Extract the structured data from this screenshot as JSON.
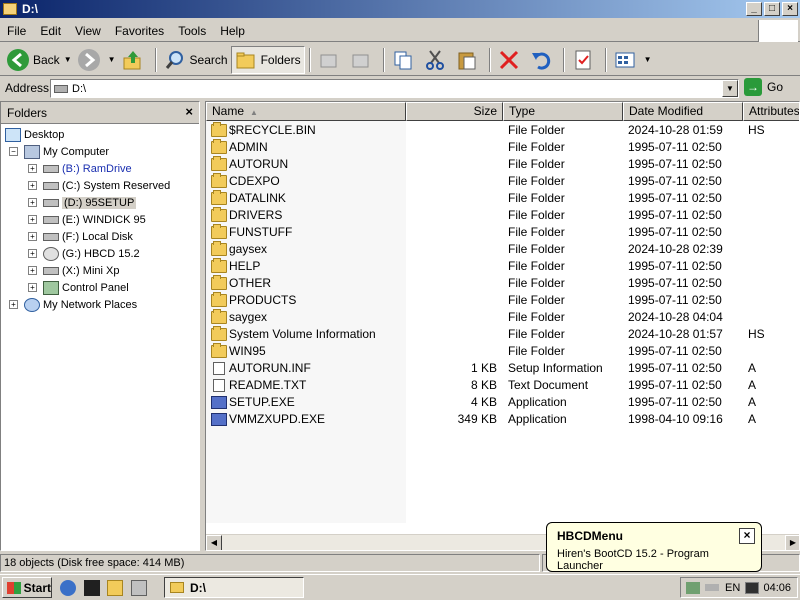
{
  "window": {
    "title": "D:\\",
    "buttons": {
      "minimize": "_",
      "maximize": "□",
      "close": "×"
    }
  },
  "menu": [
    "File",
    "Edit",
    "View",
    "Favorites",
    "Tools",
    "Help"
  ],
  "toolbar": {
    "back": "Back",
    "search": "Search",
    "folders": "Folders"
  },
  "address": {
    "label": "Address",
    "value": "D:\\",
    "go": "Go"
  },
  "folders_pane": {
    "title": "Folders",
    "close": "×",
    "tree": [
      {
        "label": "Desktop",
        "level": 0,
        "expander": "",
        "icon": "desktop-icon"
      },
      {
        "label": "My Computer",
        "level": 1,
        "expander": "−",
        "icon": "computer-icon"
      },
      {
        "label": "(B:) RamDrive",
        "level": 2,
        "expander": "+",
        "icon": "drive-icon",
        "style": "blue"
      },
      {
        "label": "(C:) System Reserved",
        "level": 2,
        "expander": "+",
        "icon": "drive-icon"
      },
      {
        "label": "(D:) 95SETUP",
        "level": 2,
        "expander": "+",
        "icon": "drive-icon",
        "style": "sel"
      },
      {
        "label": "(E:) WINDICK 95",
        "level": 2,
        "expander": "+",
        "icon": "drive-icon"
      },
      {
        "label": "(F:) Local Disk",
        "level": 2,
        "expander": "+",
        "icon": "drive-icon"
      },
      {
        "label": "(G:) HBCD 15.2",
        "level": 2,
        "expander": "+",
        "icon": "cd-drive-icon"
      },
      {
        "label": "(X:) Mini Xp",
        "level": 2,
        "expander": "+",
        "icon": "drive-icon"
      },
      {
        "label": "Control Panel",
        "level": 2,
        "expander": "+",
        "icon": "control-panel-icon"
      },
      {
        "label": "My Network Places",
        "level": 1,
        "expander": "+",
        "icon": "network-icon"
      }
    ]
  },
  "columns": {
    "name": "Name",
    "size": "Size",
    "type": "Type",
    "modified": "Date Modified",
    "attributes": "Attributes"
  },
  "files": [
    {
      "name": "$RECYCLE.BIN",
      "size": "",
      "type": "File Folder",
      "modified": "2024-10-28 01:59",
      "attr": "HS",
      "icon": "folder"
    },
    {
      "name": "ADMIN",
      "size": "",
      "type": "File Folder",
      "modified": "1995-07-11 02:50",
      "attr": "",
      "icon": "folder"
    },
    {
      "name": "AUTORUN",
      "size": "",
      "type": "File Folder",
      "modified": "1995-07-11 02:50",
      "attr": "",
      "icon": "folder"
    },
    {
      "name": "CDEXPO",
      "size": "",
      "type": "File Folder",
      "modified": "1995-07-11 02:50",
      "attr": "",
      "icon": "folder"
    },
    {
      "name": "DATALINK",
      "size": "",
      "type": "File Folder",
      "modified": "1995-07-11 02:50",
      "attr": "",
      "icon": "folder"
    },
    {
      "name": "DRIVERS",
      "size": "",
      "type": "File Folder",
      "modified": "1995-07-11 02:50",
      "attr": "",
      "icon": "folder"
    },
    {
      "name": "FUNSTUFF",
      "size": "",
      "type": "File Folder",
      "modified": "1995-07-11 02:50",
      "attr": "",
      "icon": "folder"
    },
    {
      "name": "gaysex",
      "size": "",
      "type": "File Folder",
      "modified": "2024-10-28 02:39",
      "attr": "",
      "icon": "folder"
    },
    {
      "name": "HELP",
      "size": "",
      "type": "File Folder",
      "modified": "1995-07-11 02:50",
      "attr": "",
      "icon": "folder"
    },
    {
      "name": "OTHER",
      "size": "",
      "type": "File Folder",
      "modified": "1995-07-11 02:50",
      "attr": "",
      "icon": "folder"
    },
    {
      "name": "PRODUCTS",
      "size": "",
      "type": "File Folder",
      "modified": "1995-07-11 02:50",
      "attr": "",
      "icon": "folder"
    },
    {
      "name": "saygex",
      "size": "",
      "type": "File Folder",
      "modified": "2024-10-28 04:04",
      "attr": "",
      "icon": "folder"
    },
    {
      "name": "System Volume Information",
      "size": "",
      "type": "File Folder",
      "modified": "2024-10-28 01:57",
      "attr": "HS",
      "icon": "folder"
    },
    {
      "name": "WIN95",
      "size": "",
      "type": "File Folder",
      "modified": "1995-07-11 02:50",
      "attr": "",
      "icon": "folder"
    },
    {
      "name": "AUTORUN.INF",
      "size": "1 KB",
      "type": "Setup Information",
      "modified": "1995-07-11 02:50",
      "attr": "A",
      "icon": "file"
    },
    {
      "name": "README.TXT",
      "size": "8 KB",
      "type": "Text Document",
      "modified": "1995-07-11 02:50",
      "attr": "A",
      "icon": "file"
    },
    {
      "name": "SETUP.EXE",
      "size": "4 KB",
      "type": "Application",
      "modified": "1995-07-11 02:50",
      "attr": "A",
      "icon": "exe"
    },
    {
      "name": "VMMZXUPD.EXE",
      "size": "349 KB",
      "type": "Application",
      "modified": "1998-04-10 09:16",
      "attr": "A",
      "icon": "exe"
    }
  ],
  "status": {
    "text": "18 objects (Disk free space: 414 MB)"
  },
  "balloon": {
    "title": "HBCDMenu",
    "text": "Hiren's BootCD 15.2 - Program Launcher",
    "close": "×"
  },
  "taskbar": {
    "start": "Start",
    "task": "D:\\",
    "lang": "EN",
    "clock": "04:06"
  }
}
